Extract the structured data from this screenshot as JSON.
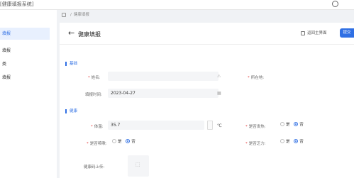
{
  "app": {
    "title": "[健康填报系统]"
  },
  "sidebar": {
    "items": [
      {
        "label": "填报",
        "active": true
      },
      {
        "label": "填报",
        "active": false
      },
      {
        "label": "类",
        "active": false
      },
      {
        "label": "填报",
        "active": false
      }
    ]
  },
  "breadcrumb": {
    "separator": "/",
    "current": "健康填报"
  },
  "header": {
    "title": "健康填报",
    "return_label": "返回主界面",
    "submit_label": "提交"
  },
  "sections": {
    "basic": "基础",
    "health": "健康"
  },
  "form": {
    "name_label": "姓名:",
    "name_value": "",
    "location_label": "所在地:",
    "date_label": "填报时间:",
    "date_value": "2023-04-27",
    "temp_label": "体温:",
    "temp_value": "35.7",
    "temp_unit": "℃",
    "cough_label": "是否咳嗽:",
    "fever_label": "是否发热:",
    "contact_label": "是否接触:",
    "fatigue_label": "是否乏力:",
    "yes": "是",
    "no": "否",
    "upload_label": "健康码上传:"
  },
  "colors": {
    "accent": "#2f6fe4",
    "required": "#e54545"
  }
}
